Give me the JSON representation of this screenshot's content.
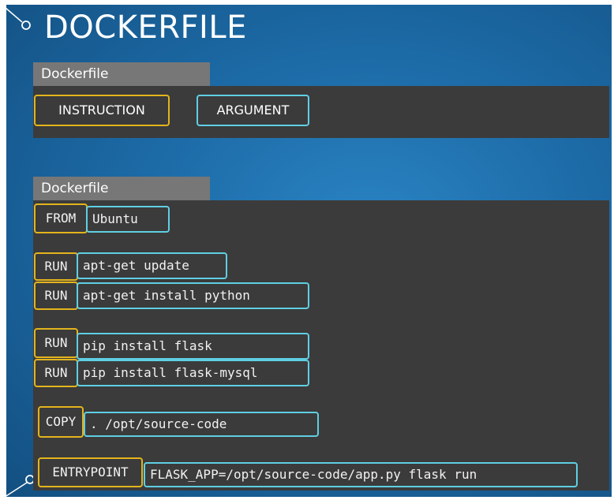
{
  "title": "DOCKERFILE",
  "legend": {
    "tab": "Dockerfile",
    "instruction": "INSTRUCTION",
    "argument": "ARGUMENT"
  },
  "file": {
    "tab": "Dockerfile",
    "lines": [
      {
        "instruction": "FROM",
        "argument": "Ubuntu"
      },
      {
        "instruction": "RUN",
        "argument": "apt-get update"
      },
      {
        "instruction": "RUN",
        "argument": "apt-get install python"
      },
      {
        "instruction": "RUN",
        "argument": "pip install flask"
      },
      {
        "instruction": "RUN",
        "argument": "pip install flask-mysql"
      },
      {
        "instruction": "COPY",
        "argument": ". /opt/source-code"
      },
      {
        "instruction": "ENTRYPOINT",
        "argument": "FLASK_APP=/opt/source-code/app.py flask run"
      }
    ]
  },
  "colors": {
    "instruction_border": "#e3b41c",
    "argument_border": "#5fcfe3",
    "panel": "#3b3b3b",
    "tab": "#777777",
    "background": "#1c6aa6"
  },
  "icons": [
    "corner-circle-icon"
  ]
}
